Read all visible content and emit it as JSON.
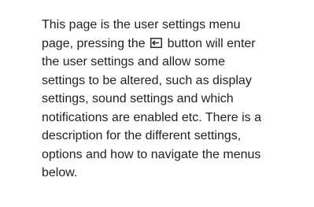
{
  "paragraph": {
    "line1": "This page is the user settings menu",
    "line2_before_icon": "page, pressing the",
    "line2_after_icon": "button will enter",
    "line3": "the user settings and allow some",
    "line4": "settings to be altered, such as display",
    "line5": "settings, sound settings and which",
    "line6": "notifications are enabled etc. There is a",
    "line7": "description for the different settings,",
    "line8": "options and how to navigate the menus",
    "line9": "below."
  },
  "icons": {
    "inline_button": "enter-icon"
  }
}
